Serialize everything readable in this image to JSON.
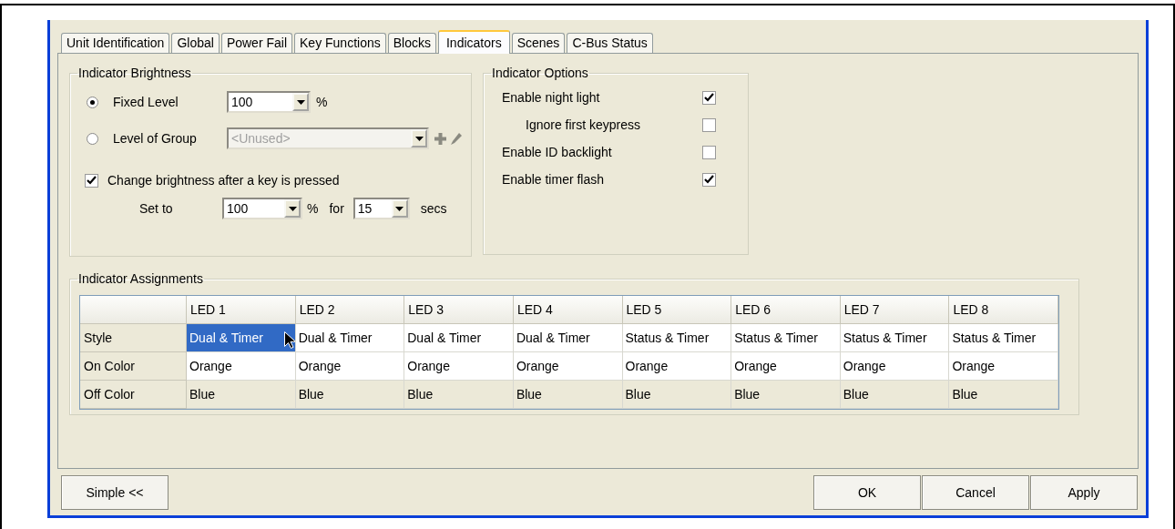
{
  "tabs": [
    {
      "label": "Unit Identification",
      "selected": false
    },
    {
      "label": "Global",
      "selected": false
    },
    {
      "label": "Power Fail",
      "selected": false
    },
    {
      "label": "Key Functions",
      "selected": false
    },
    {
      "label": "Blocks",
      "selected": false
    },
    {
      "label": "Indicators",
      "selected": true
    },
    {
      "label": "Scenes",
      "selected": false
    },
    {
      "label": "C-Bus Status",
      "selected": false
    }
  ],
  "brightness": {
    "title": "Indicator Brightness",
    "modes": [
      {
        "label": "Fixed Level",
        "selected": true,
        "value": "100",
        "disabled": false,
        "unit": "%"
      },
      {
        "label": "Level of Group",
        "selected": false,
        "value": "<Unused>",
        "disabled": true
      }
    ],
    "change_after_key": {
      "label": "Change brightness after a key is pressed",
      "checked": true
    },
    "set_to": {
      "label": "Set to",
      "level_value": "100",
      "level_unit": "%",
      "for_label": "for",
      "duration_value": "15",
      "duration_unit": "secs"
    }
  },
  "options": {
    "title": "Indicator Options",
    "items": [
      {
        "label": "Enable night light",
        "checked": true,
        "indented": false
      },
      {
        "label": "Ignore first keypress",
        "checked": false,
        "indented": true
      },
      {
        "label": "Enable ID backlight",
        "checked": false,
        "indented": false
      },
      {
        "label": "Enable timer flash",
        "checked": true,
        "indented": false
      }
    ]
  },
  "assignments": {
    "title": "Indicator Assignments",
    "columns": [
      "LED 1",
      "LED 2",
      "LED 3",
      "LED 4",
      "LED 5",
      "LED 6",
      "LED 7",
      "LED 8"
    ],
    "rows": [
      {
        "label": "Style",
        "shaded": false,
        "cells": [
          {
            "text": "Dual & Timer",
            "selected": true
          },
          {
            "text": "Dual & Timer",
            "selected": false
          },
          {
            "text": "Dual & Timer",
            "selected": false
          },
          {
            "text": "Dual & Timer",
            "selected": false
          },
          {
            "text": "Status & Timer",
            "selected": false
          },
          {
            "text": "Status & Timer",
            "selected": false
          },
          {
            "text": "Status & Timer",
            "selected": false
          },
          {
            "text": "Status & Timer",
            "selected": false
          }
        ]
      },
      {
        "label": "On Color",
        "shaded": false,
        "cells": [
          {
            "text": "Orange",
            "selected": false
          },
          {
            "text": "Orange",
            "selected": false
          },
          {
            "text": "Orange",
            "selected": false
          },
          {
            "text": "Orange",
            "selected": false
          },
          {
            "text": "Orange",
            "selected": false
          },
          {
            "text": "Orange",
            "selected": false
          },
          {
            "text": "Orange",
            "selected": false
          },
          {
            "text": "Orange",
            "selected": false
          }
        ]
      },
      {
        "label": "Off Color",
        "shaded": true,
        "cells": [
          {
            "text": "Blue",
            "selected": false
          },
          {
            "text": "Blue",
            "selected": false
          },
          {
            "text": "Blue",
            "selected": false
          },
          {
            "text": "Blue",
            "selected": false
          },
          {
            "text": "Blue",
            "selected": false
          },
          {
            "text": "Blue",
            "selected": false
          },
          {
            "text": "Blue",
            "selected": false
          },
          {
            "text": "Blue",
            "selected": false
          }
        ]
      }
    ]
  },
  "buttons_left": [
    "Simple <<"
  ],
  "buttons_right": [
    "OK",
    "Cancel",
    "Apply"
  ]
}
